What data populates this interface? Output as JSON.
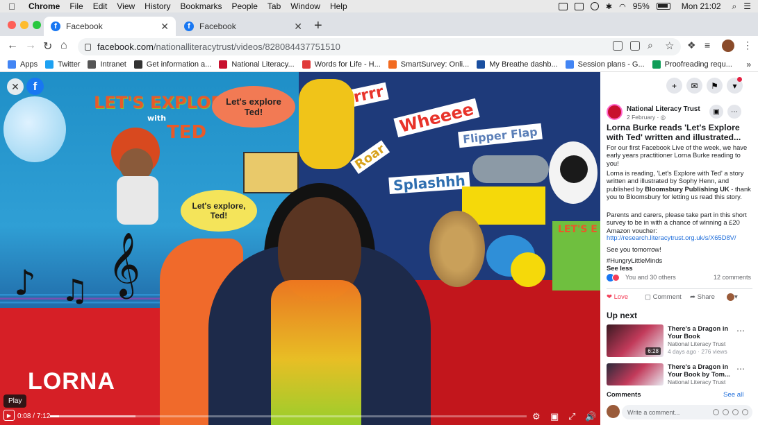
{
  "menubar": {
    "items": [
      "Chrome",
      "File",
      "Edit",
      "View",
      "History",
      "Bookmarks",
      "People",
      "Tab",
      "Window",
      "Help"
    ],
    "battery": "95%",
    "clock": "Mon 21:02"
  },
  "tabs": [
    {
      "title": "Facebook"
    },
    {
      "title": "Facebook"
    }
  ],
  "address": {
    "host": "facebook.com",
    "path": "/nationalliteracytrust/videos/828084437751510"
  },
  "bookmarks": [
    {
      "label": "Apps",
      "color": "#4285f4"
    },
    {
      "label": "Twitter",
      "color": "#1da1f2"
    },
    {
      "label": "Intranet",
      "color": "#555555"
    },
    {
      "label": "Get information a...",
      "color": "#333333"
    },
    {
      "label": "National Literacy...",
      "color": "#c8102e"
    },
    {
      "label": "Words for Life - H...",
      "color": "#e03a3a"
    },
    {
      "label": "SmartSurvey: Onli...",
      "color": "#f26b21"
    },
    {
      "label": "My Breathe dashb...",
      "color": "#1a4fa0"
    },
    {
      "label": "Session plans - G...",
      "color": "#4285f4"
    },
    {
      "label": "Proofreading requ...",
      "color": "#0f9d58"
    }
  ],
  "video": {
    "scene": {
      "banner": "LET'S EXPLORE",
      "banner_with": "with",
      "banner_ted": "TED",
      "bubble1": "Let's explore Ted!",
      "bubble2": "Let's explore, Ted!",
      "grrr": "Grrrr",
      "wheeee": "Wheeee",
      "flipper": "Flipper Flap",
      "splash": "Splashhh",
      "roar": "Roar",
      "book": "LET'S E"
    },
    "caption": "LORNA",
    "tooltip": "Play",
    "time_current": "0:08",
    "time_total": "7:12",
    "progress": 0.019,
    "buffered": 0.18
  },
  "post": {
    "page_name": "National Literacy Trust",
    "date": "2 February · ",
    "title": "Lorna Burke reads 'Let's Explore with Ted' written and illustrated...",
    "para1": "For our first Facebook Live of the week, we have early years practitioner Lorna Burke reading to you!",
    "para2_a": "Lorna is reading, 'Let's Explore with Ted' a story written and illustrated by Sophy Henn, and published by ",
    "para2_bold": "Bloomsbury Publishing UK",
    "para2_b": " - thank you to Bloomsbury for letting us read this story.",
    "para3": "Parents and carers, please take part in this short survey to be in with a chance of winning a £20 Amazon voucher:",
    "link": "http://research.literacytrust.org.uk/s/X65D8V/",
    "para4": "See you tomorrow!",
    "hashtag": "#HungryLittleMinds",
    "see_less": "See less",
    "reactions": "You and 30 others",
    "comments_count": "12 comments",
    "love": "Love",
    "comment": "Comment",
    "share": "Share"
  },
  "up_next": {
    "heading": "Up next",
    "items": [
      {
        "title": "There's a Dragon in Your Book",
        "page": "National Literacy Trust",
        "meta": "4 days ago · 276 views",
        "duration": "6:28"
      },
      {
        "title": "There's a Dragon in Your Book by Tom...",
        "page": "National Literacy Trust",
        "meta": "",
        "duration": ""
      }
    ]
  },
  "comments": {
    "heading": "Comments",
    "see_all": "See all",
    "placeholder": "Write a comment..."
  },
  "colors": {
    "facebook_blue": "#1877f2",
    "love_red": "#f33e58"
  }
}
